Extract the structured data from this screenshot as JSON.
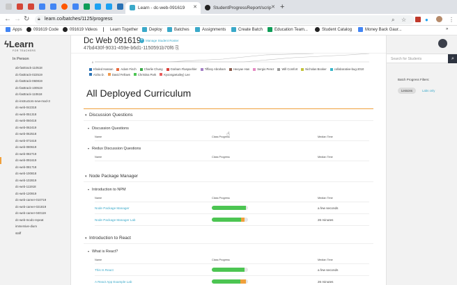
{
  "browser": {
    "active_tab": "Learn - dc-web-091619",
    "other_tab": "StudentProgressReport/scrip",
    "url": "learn.co/batches/1125/progress",
    "bookmarks": [
      "Apps",
      "091619 Code",
      "091619 Videos",
      "Learn Together",
      "Deploy",
      "Batches",
      "Assignments",
      "Create Batch",
      "Education Team...",
      "Student Catalog",
      "Money Back Gaur..."
    ]
  },
  "sidebar": {
    "logo": "Learn",
    "logo_sub": "FOR TEACHERS",
    "heading": "In Person",
    "items": [
      "ab-fasttrack-110518",
      "dc-fasttrack-022519",
      "dc-fasttrack-060819",
      "dc-fasttrack-100519",
      "dc-fasttrack-110618",
      "dc-instructors-new-mod-3",
      "dc-web-042318",
      "dc-web-051318",
      "dc-web-060418",
      "dc-web-062419",
      "dc-web-062518",
      "dc-web-071618",
      "dc-web-080619",
      "dc-web-082719",
      "dc-web-091619",
      "dc-web-081718",
      "dc-web-100818",
      "dc-web-102819",
      "dc-web-111918",
      "dc-web-120919",
      "dc-web-career-010719",
      "dc-web-career-021819",
      "dc-web-career-040119",
      "dc-web-mod1-repeat",
      "immersive-dium",
      "staff"
    ],
    "active_index": 14
  },
  "header": {
    "title": "Dc Web 091619",
    "manage_button": "Manage Student Roster",
    "hash": "47bd430f-9031-459e-b6d1-1150591b70f6"
  },
  "legend": [
    {
      "name": "Khaled Hassan",
      "color": "#2a72b5"
    },
    {
      "name": "Adam Finch",
      "color": "#e8693c"
    },
    {
      "name": "Charlie Chung",
      "color": "#3cab4a"
    },
    {
      "name": "Graham Flaspoehler",
      "color": "#d9403a"
    },
    {
      "name": "Tiffany Abraham",
      "color": "#a47fc6"
    },
    {
      "name": "Heeyae Han",
      "color": "#8c5c4c"
    },
    {
      "name": "Sergio Perez",
      "color": "#e58ac3"
    },
    {
      "name": "Will Comfort",
      "color": "#999999"
    },
    {
      "name": "Nicholas Booker",
      "color": "#c2c23a"
    },
    {
      "name": "collaborative-bug-2010",
      "color": "#36b6c9"
    },
    {
      "name": "Aicha D.",
      "color": "#2a72b5"
    },
    {
      "name": "David Fellows",
      "color": "#f09b4f"
    },
    {
      "name": "Christina Park",
      "color": "#4cc552"
    },
    {
      "name": "KyoongaKailey) Lee",
      "color": "#e85b5b"
    }
  ],
  "main": {
    "section_title": "All Deployed Curriculum",
    "col_name": "Name",
    "col_progress": "Class Progress",
    "col_median": "Median Time",
    "courses": [
      {
        "title": "Discussion Questions",
        "units": [
          {
            "title": "Discussion Questions",
            "lessons": []
          },
          {
            "title": "Redux Discussion Questions",
            "lessons": []
          }
        ]
      },
      {
        "title": "Node Package Manager",
        "units": [
          {
            "title": "Introduction to NPM",
            "lessons": [
              {
                "name": "Node Package Manager",
                "progress": 0.95,
                "orange": 0.0,
                "median": "a few seconds"
              },
              {
                "name": "Node Package Manager Lab",
                "progress": 0.8,
                "orange": 0.1,
                "median": "26 minutes"
              }
            ]
          }
        ]
      },
      {
        "title": "Introduction to React",
        "units": [
          {
            "title": "What is React?",
            "lessons": [
              {
                "name": "This Is React",
                "progress": 0.9,
                "orange": 0.0,
                "median": "a few seconds"
              },
              {
                "name": "A React App Example Lab",
                "progress": 0.78,
                "orange": 0.16,
                "median": "26 minutes"
              }
            ]
          }
        ]
      }
    ]
  },
  "rightbar": {
    "search_placeholder": "Search for Students",
    "filters_label": "Batch Progress Filters:",
    "filter_on": "Lessons",
    "filter_off": "Labs only"
  }
}
